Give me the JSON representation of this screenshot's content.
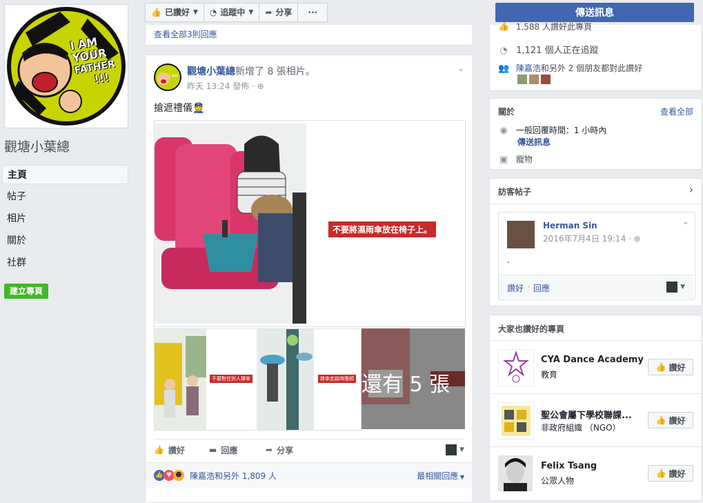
{
  "page": {
    "name": "觀塘小葉總",
    "avatar_text": [
      "I AM",
      "YOUR",
      "FATHER",
      "!!!"
    ]
  },
  "nav": {
    "items": [
      "主頁",
      "帖子",
      "相片",
      "關於",
      "社群"
    ],
    "active": 0,
    "create_page": "建立專頁"
  },
  "toolbar": {
    "liked": "已讚好",
    "following": "追蹤中",
    "share": "分享",
    "more": "···",
    "send_message": "傳送訊息"
  },
  "prev_post": {
    "view_all_replies": "查看全部3則回應"
  },
  "post": {
    "author": "觀塘小葉總",
    "action": "新增了 8 張相片。",
    "time": "昨天 13:24 發佈 ·",
    "text": "搶遮禮儀👮",
    "main_caption": "不要將濕雨傘放在椅子上。",
    "thumb1_caption": "不要對住別人揮傘",
    "thumb2_caption": "揸傘走路時應順",
    "more_photos": "還有 5 張",
    "actions": {
      "like": "讚好",
      "comment": "回應",
      "share": "分享"
    },
    "reactions_text": "陳嘉浩和另外 1,809 人",
    "sort": "最相關回應"
  },
  "stats": {
    "likes_partial": "1,588 人讚好此專頁",
    "followers": "1,121 個人正在追蹤",
    "friends_like_name": "陳嘉浩",
    "friends_like_rest": "和另外 2 個朋友都對此讚好"
  },
  "about": {
    "title": "關於",
    "see_all": "查看全部",
    "response_time": "一般回覆時間：1 小時內",
    "send_message": "傳送訊息",
    "category": "寵物"
  },
  "visitor_posts": {
    "title": "訪客帖子",
    "author": "Herman Sin",
    "time": "2016年7月4日 19:14 ·",
    "body": ".",
    "like": "讚好",
    "comment": "回應"
  },
  "liked_pages": {
    "title": "大家也讚好的專頁",
    "like_label": "讚好",
    "items": [
      {
        "name": "CYA Dance Academy",
        "category": "教育"
      },
      {
        "name": "聖公會屬下學校聯課...",
        "category": "非政府組織 （NGO）"
      },
      {
        "name": "Felix Tsang",
        "category": "公眾人物"
      }
    ]
  },
  "colors": {
    "brand": "#4267b2",
    "link": "#365899",
    "green": "#42b72a",
    "bg": "#e9ebee"
  }
}
